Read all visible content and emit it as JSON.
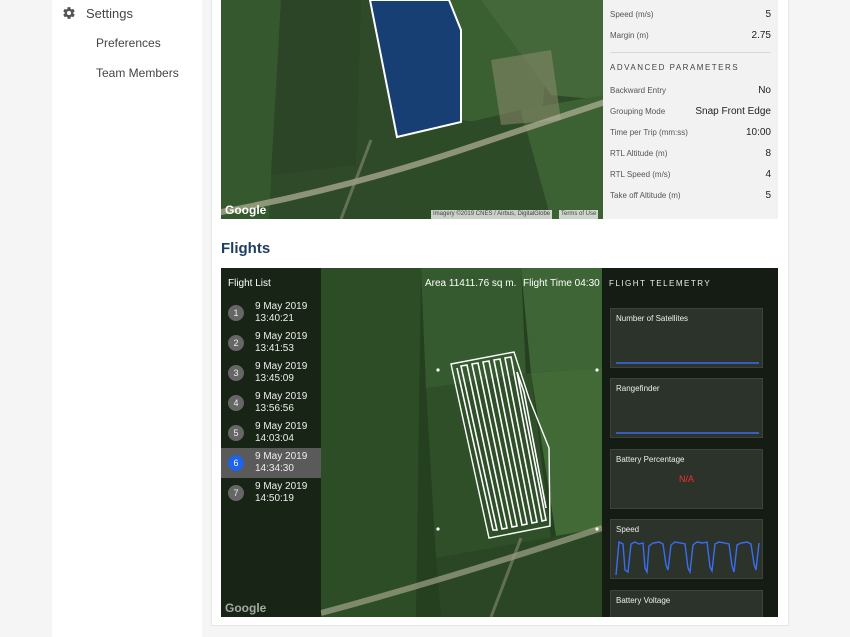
{
  "sidebar": {
    "settings_label": "Settings",
    "items": [
      {
        "label": "Preferences"
      },
      {
        "label": "Team Members"
      }
    ]
  },
  "mission_params": {
    "speed_label": "Speed (m/s)",
    "speed_value": "5",
    "margin_label": "Margin (m)",
    "margin_value": "2.75",
    "advanced_title": "ADVANCED PARAMETERS",
    "advanced": [
      {
        "label": "Backward Entry",
        "value": "No"
      },
      {
        "label": "Grouping Mode",
        "value": "Snap Front Edge"
      },
      {
        "label": "Time per Trip (mm:ss)",
        "value": "10:00"
      },
      {
        "label": "RTL Altitude (m)",
        "value": "8"
      },
      {
        "label": "RTL Speed (m/s)",
        "value": "4"
      },
      {
        "label": "Take off Altitude (m)",
        "value": "5"
      }
    ]
  },
  "map_top": {
    "google_label": "Google",
    "imagery": "Imagery ©2019 CNES / Airbus, DigitalGlobe",
    "terms": "Terms of Use"
  },
  "flights": {
    "title": "Flights",
    "list_title": "Flight List",
    "area": "Area 11411.76 sq m.",
    "flight_time": "Flight Time 04:30",
    "items": [
      {
        "num": "1",
        "date": "9 May 2019",
        "time": "13:40:21",
        "active": false
      },
      {
        "num": "2",
        "date": "9 May 2019",
        "time": "13:41:53",
        "active": false
      },
      {
        "num": "3",
        "date": "9 May 2019",
        "time": "13:45:09",
        "active": false
      },
      {
        "num": "4",
        "date": "9 May 2019",
        "time": "13:56:56",
        "active": false
      },
      {
        "num": "5",
        "date": "9 May 2019",
        "time": "14:03:04",
        "active": false
      },
      {
        "num": "6",
        "date": "9 May 2019",
        "time": "14:34:30",
        "active": true
      },
      {
        "num": "7",
        "date": "9 May 2019",
        "time": "14:50:19",
        "active": false
      }
    ],
    "google_label": "Google"
  },
  "telemetry": {
    "title": "FLIGHT TELEMETRY",
    "cards": [
      {
        "label": "Number of Satellites"
      },
      {
        "label": "Rangefinder"
      },
      {
        "label": "Battery Percentage",
        "status": "N/A"
      },
      {
        "label": "Speed"
      },
      {
        "label": "Battery Voltage"
      }
    ]
  },
  "colors": {
    "accent_blue": "#1e63e9",
    "title_navy": "#1c3e63",
    "na_red": "#ff2a2a",
    "field_green": "#2f4a28"
  }
}
